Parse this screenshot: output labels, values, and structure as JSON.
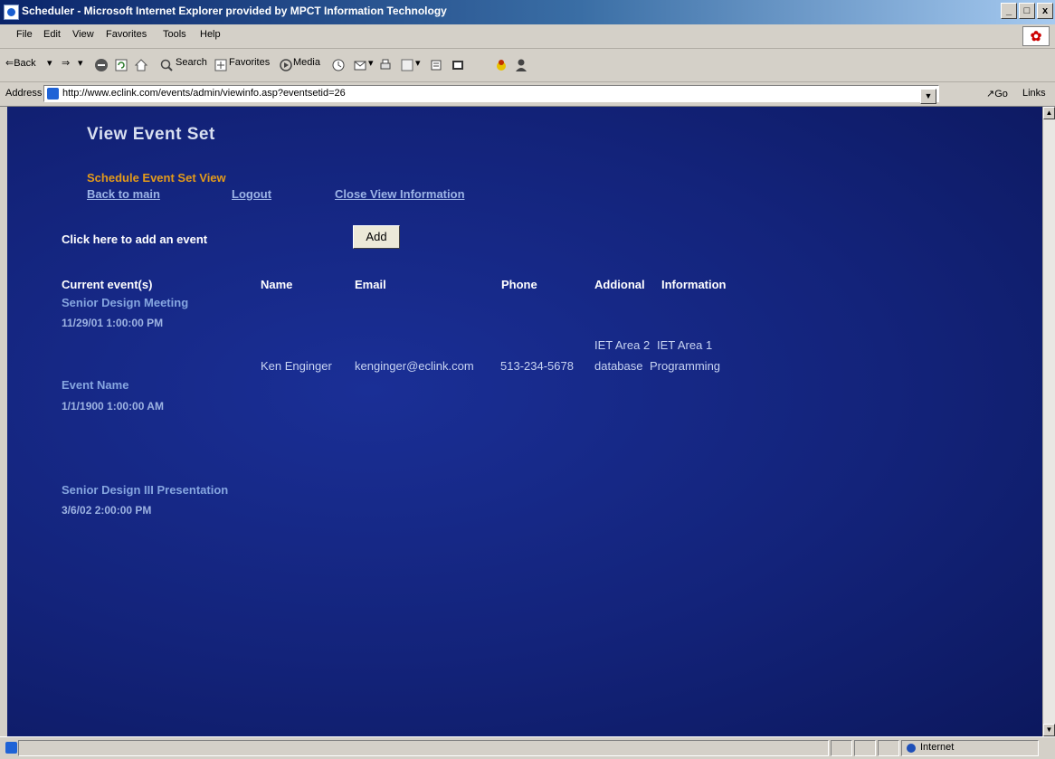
{
  "window": {
    "title": "Scheduler - Microsoft Internet Explorer provided by MPCT Information Technology",
    "buttons": [
      "_",
      "□",
      "x"
    ]
  },
  "menu": [
    "File",
    "Edit",
    "View",
    "Favorites",
    "Tools",
    "Help"
  ],
  "toolbar": {
    "back": "⇐Back",
    "search": "Search",
    "favorites": "Favorites",
    "media": "Media"
  },
  "address": {
    "label": "Address",
    "url": "http://www.eclink.com/events/admin/viewinfo.asp?eventsetid=26",
    "go": "Go",
    "links": "Links"
  },
  "page": {
    "title": "View Event Set",
    "subtitle": "Schedule Event Set View",
    "nav": [
      "Back to main",
      "Logout",
      "Close View Information"
    ],
    "add_label": "Click here to add an event",
    "add_button": "Add",
    "headers": [
      "Current event(s)",
      "Name",
      "Email",
      "Phone",
      "Addional",
      "Information"
    ],
    "events": [
      {
        "name": "Senior Design Meeting",
        "date": "11/29/01 1:00:00 PM"
      },
      {
        "name": "Event Name",
        "date": "1/1/1900 1:00:00 AM"
      },
      {
        "name": "Senior Design III Presentation",
        "date": "3/6/02 2:00:00 PM"
      }
    ],
    "attendee": {
      "name": "Ken Enginger",
      "email": "kenginger@eclink.com",
      "phone": "513-234-5678",
      "additional_line1": "IET Area 2",
      "additional_line2": "database",
      "information_line1": "IET Area 1",
      "information_line2": "Programming"
    }
  },
  "status": {
    "zone": "Internet"
  }
}
